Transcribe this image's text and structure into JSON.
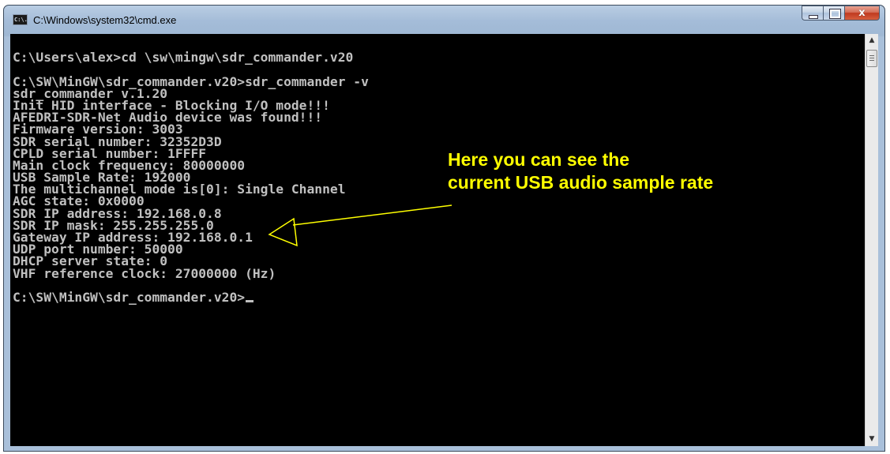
{
  "window": {
    "title": "C:\\Windows\\system32\\cmd.exe",
    "icon": "cmd-icon",
    "icon_text": "C:\\.",
    "controls": {
      "minimize": "minimize-icon",
      "maximize": "maximize-icon",
      "close": "close-icon",
      "close_glyph": "x"
    }
  },
  "console": {
    "lines": [
      "",
      "C:\\Users\\alex>cd \\sw\\mingw\\sdr_commander.v20",
      "",
      "C:\\SW\\MinGW\\sdr_commander.v20>sdr_commander -v",
      "sdr_commander v.1.20",
      "Init HID interface - Blocking I/O mode!!!",
      "AFEDRI-SDR-Net Audio device was found!!!",
      "Firmware version: 3003",
      "SDR serial number: 32352D3D",
      "CPLD serial number: 1FFFF",
      "Main clock frequency: 80000000",
      "USB Sample Rate: 192000",
      "The multichannel mode is[0]: Single Channel",
      "AGC state: 0x0000",
      "SDR IP address: 192.168.0.8",
      "SDR IP mask: 255.255.255.0",
      "Gateway IP address: 192.168.0.1",
      "UDP port number: 50000",
      "DHCP server state: 0",
      "VHF reference clock: 27000000 (Hz)",
      "",
      "C:\\SW\\MinGW\\sdr_commander.v20>"
    ]
  },
  "annotation": {
    "line1": "Here you can see the",
    "line2": "current USB audio sample rate",
    "color": "#ffff00"
  },
  "colors": {
    "console_bg": "#000000",
    "console_text": "#c0c0c0",
    "frame": "#a9c0da"
  }
}
